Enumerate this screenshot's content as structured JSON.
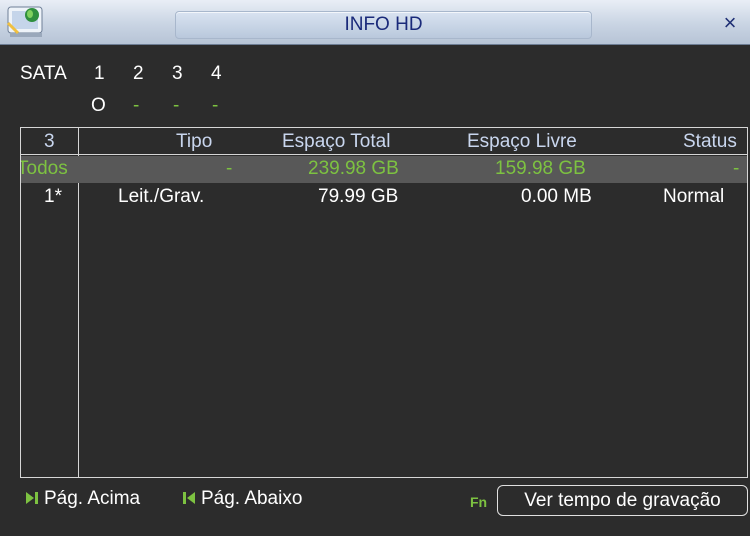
{
  "window": {
    "title": "INFO HD"
  },
  "sata": {
    "label": "SATA",
    "ports": [
      "1",
      "2",
      "3",
      "4"
    ],
    "status": [
      "O",
      "-",
      "-",
      "-"
    ]
  },
  "table": {
    "headers": [
      "3",
      "Tipo",
      "Espaço Total",
      "Espaço Livre",
      "Status"
    ],
    "summary_row": [
      "Todos",
      "-",
      "239.98 GB",
      "159.98 GB",
      "-"
    ],
    "rows": [
      [
        "1*",
        "Leit./Grav.",
        "79.99 GB",
        "0.00 MB",
        "Normal"
      ]
    ]
  },
  "footer": {
    "page_up": "Pág. Acima",
    "page_down": "Pág. Abaixo",
    "fn_label": "Fn",
    "record_time_button": "Ver tempo de gravação"
  },
  "colors": {
    "accent_green": "#7dc241",
    "header_text": "#c9d6ee",
    "selected_row": "#585858",
    "title_text": "#1a2a7a"
  },
  "icons": [
    "hdd-info-icon",
    "close-icon",
    "page-up-icon",
    "page-down-icon",
    "fn-icon"
  ]
}
